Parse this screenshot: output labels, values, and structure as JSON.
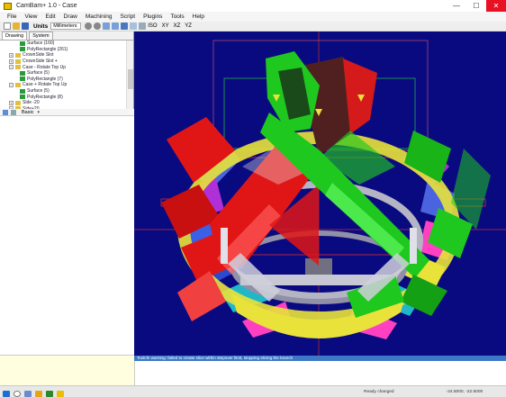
{
  "window": {
    "title": "CamBam+ 1.0 - Case",
    "minimize": "—",
    "maximize": "☐",
    "close": "✕"
  },
  "menu": [
    "File",
    "View",
    "Edit",
    "Draw",
    "Machining",
    "Script",
    "Plugins",
    "Tools",
    "Help"
  ],
  "toolbar": {
    "units_label": "Units",
    "units_value": "Millimeters",
    "views": [
      "ISO",
      "XY",
      "XZ",
      "YZ"
    ]
  },
  "tabs": [
    "Drawing",
    "System"
  ],
  "tree": [
    {
      "label": "Surface (160)",
      "indent": 3,
      "toggle": "",
      "icon": "green"
    },
    {
      "label": "PolyRectangle (261)",
      "indent": 3,
      "toggle": "",
      "icon": "green"
    },
    {
      "label": "CrownSide Slot",
      "indent": 1,
      "toggle": "+",
      "icon": "yellow"
    },
    {
      "label": "CrownSide Slot +",
      "indent": 1,
      "toggle": "+",
      "icon": "yellow"
    },
    {
      "label": "Case - Rotate Top Up",
      "indent": 1,
      "toggle": "−",
      "icon": "yellow"
    },
    {
      "label": "Surface (5)",
      "indent": 3,
      "toggle": "",
      "icon": "green"
    },
    {
      "label": "PolyRectangle (7)",
      "indent": 3,
      "toggle": "",
      "icon": "green"
    },
    {
      "label": "Case + Rotate Top Up",
      "indent": 1,
      "toggle": "−",
      "icon": "yellow"
    },
    {
      "label": "Surface (5)",
      "indent": 3,
      "toggle": "",
      "icon": "green"
    },
    {
      "label": "PolyRectangle (8)",
      "indent": 3,
      "toggle": "",
      "icon": "green"
    },
    {
      "label": "Side -20",
      "indent": 1,
      "toggle": "+",
      "icon": "yellow"
    },
    {
      "label": "Side+20",
      "indent": 1,
      "toggle": "−",
      "icon": "yellow"
    },
    {
      "label": "Surface (8)",
      "indent": 3,
      "toggle": "",
      "icon": "green"
    },
    {
      "label": "PolyRectangle (12)",
      "indent": 3,
      "toggle": "",
      "icon": "green"
    },
    {
      "label": "GROOVE-BAY",
      "indent": 1,
      "toggle": "+",
      "icon": "yellow"
    }
  ],
  "props": {
    "mode": "Basic",
    "mode_arrow": "▾"
  },
  "message": "Toolchi warning: failed to create slice within stepover limit, stopping slicing the branch",
  "status": {
    "left": "Ready changed",
    "coords": "-24.5000, -22.5000"
  },
  "colors": {
    "viewport": "#0a0a80",
    "red": "#e01616",
    "green": "#1ec81e",
    "yellow": "#e8e23a",
    "purple": "#b030d8",
    "magenta": "#ff40c0",
    "cyan": "#20b8c8",
    "blue": "#4a64e0",
    "grey": "#b4b4c4",
    "dark_red": "#502020",
    "dark_green": "#1a4a1a",
    "msgbar": "#3d78c8"
  }
}
